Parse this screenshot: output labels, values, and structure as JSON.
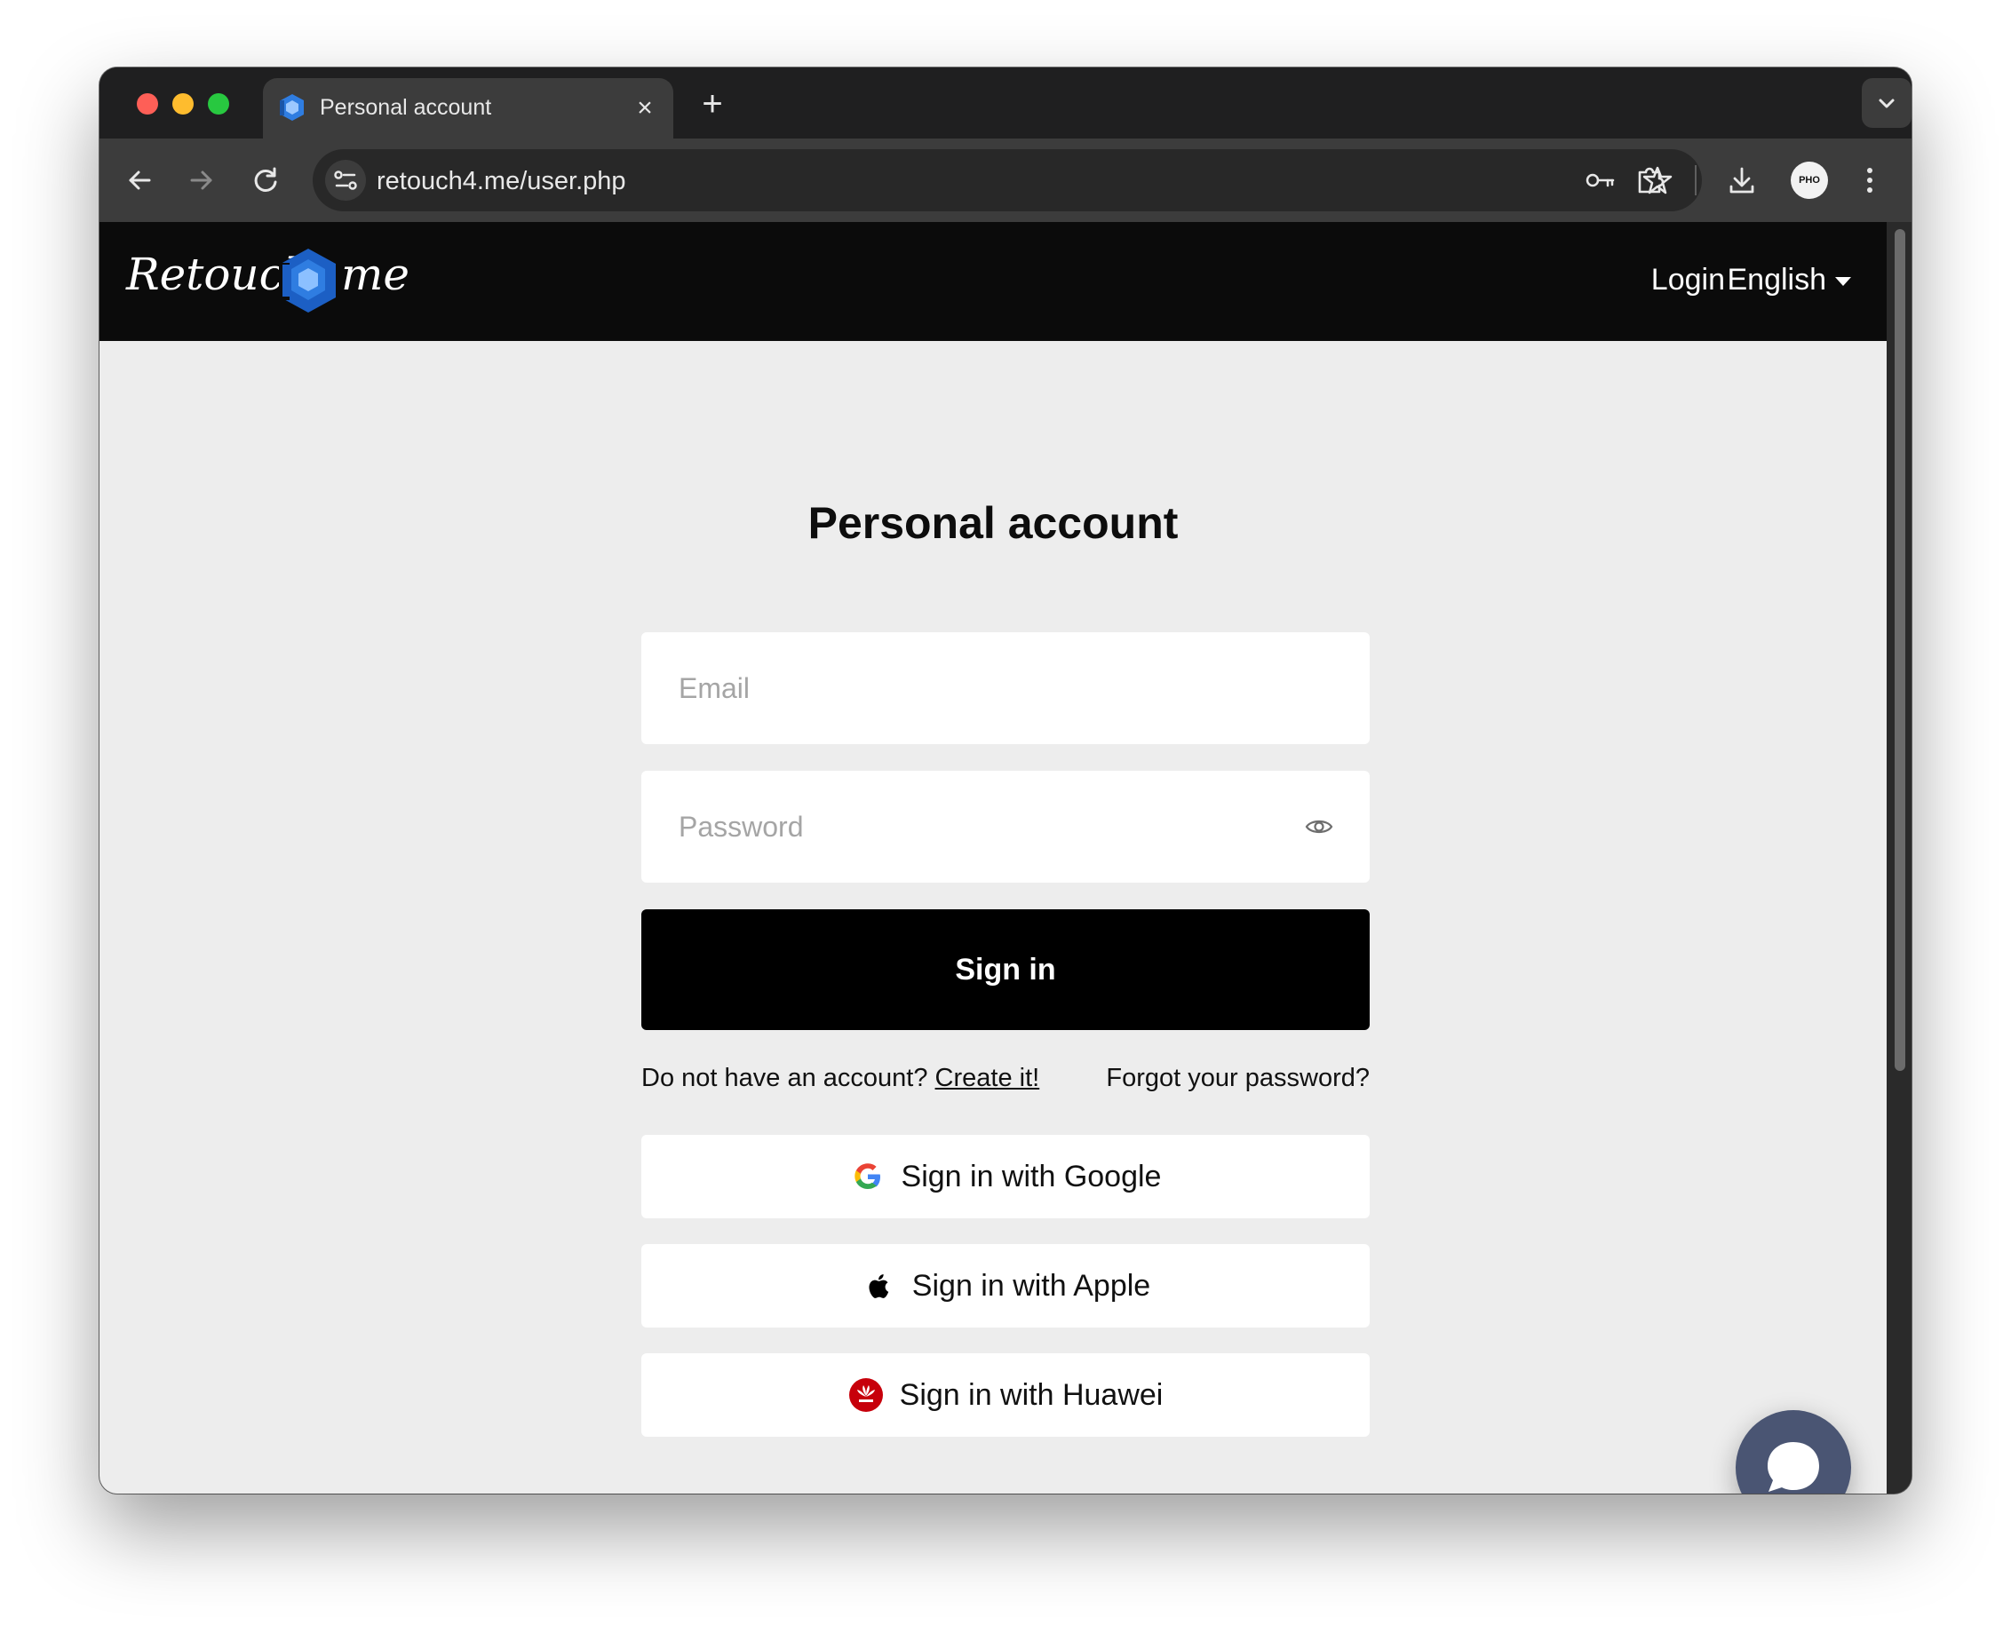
{
  "browser": {
    "tab": {
      "title": "Personal account"
    },
    "address_bar": {
      "url": "retouch4.me/user.php"
    },
    "profile_avatar_text": "PHO"
  },
  "site_header": {
    "logo": {
      "word_left": "Retouch",
      "word_right": "me"
    },
    "login_label": "Login",
    "language_label": "English"
  },
  "page": {
    "title": "Personal account",
    "email_placeholder": "Email",
    "password_placeholder": "Password",
    "signin_label": "Sign in",
    "no_account_text": "Do not have an account?",
    "create_link": "Create it!",
    "forgot_link": "Forgot your password?",
    "social_buttons": [
      {
        "label": "Sign in with Google",
        "icon": "google-icon"
      },
      {
        "label": "Sign in with Apple",
        "icon": "apple-icon"
      },
      {
        "label": "Sign in with Huawei",
        "icon": "huawei-icon"
      }
    ]
  },
  "colors": {
    "header_bg": "#0b0b0b",
    "page_bg": "#ededed",
    "primary_button": "#000000",
    "chat_bubble": "#4a5573",
    "logo_accent": "#2f7de1"
  }
}
